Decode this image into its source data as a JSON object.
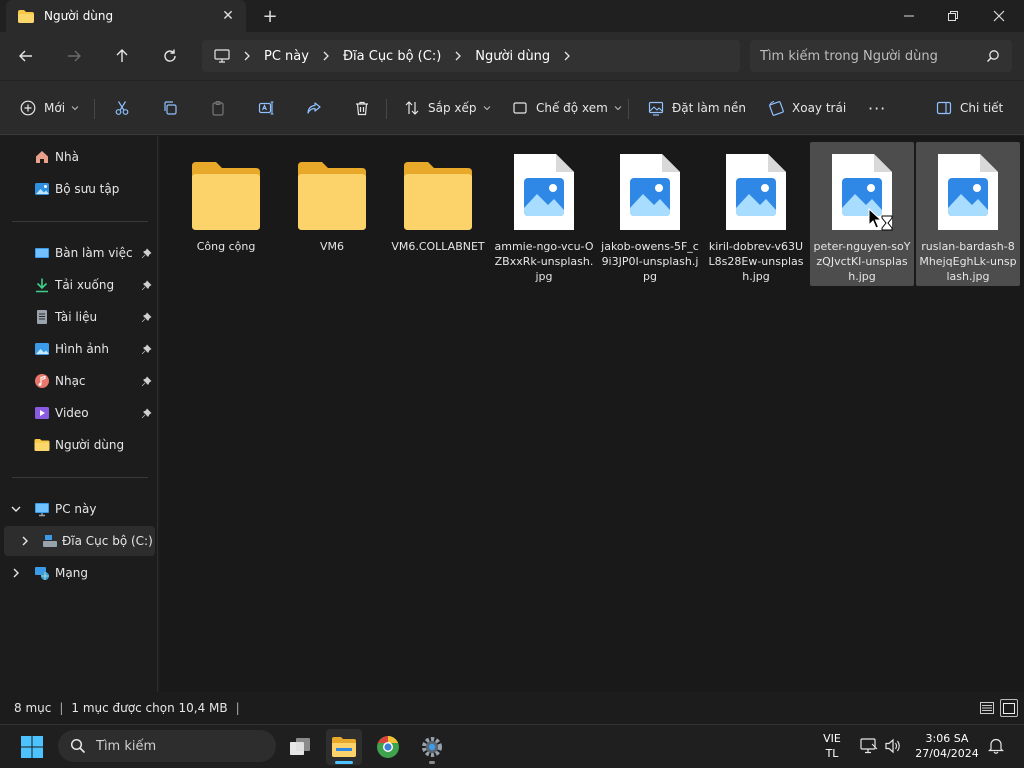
{
  "window": {
    "tab_title": "Người dùng",
    "close_tab": "✕",
    "new_tab": "+"
  },
  "address": {
    "breadcrumb": [
      "PC này",
      "Đĩa Cục bộ (C:)",
      "Người dùng"
    ],
    "search_placeholder": "Tìm kiếm trong Người dùng"
  },
  "toolbar": {
    "new_label": "Mới",
    "sort_label": "Sắp xếp",
    "view_label": "Chế độ xem",
    "set_background_label": "Đặt làm nền",
    "rotate_left_label": "Xoay trái",
    "more_label": "···",
    "details_label": "Chi tiết"
  },
  "sidebar": {
    "home": "Nhà",
    "gallery": "Bộ sưu tập",
    "pinned": [
      {
        "label": "Bàn làm việc",
        "icon": "desktop-icon"
      },
      {
        "label": "Tải xuống",
        "icon": "download-icon"
      },
      {
        "label": "Tài liệu",
        "icon": "documents-icon"
      },
      {
        "label": "Hình ảnh",
        "icon": "pictures-icon"
      },
      {
        "label": "Nhạc",
        "icon": "music-icon"
      },
      {
        "label": "Video",
        "icon": "video-icon"
      },
      {
        "label": "Người dùng",
        "icon": "folder-icon"
      }
    ],
    "this_pc": "PC này",
    "local_disk": "Đĩa Cục bộ (C:)",
    "network": "Mạng"
  },
  "files": [
    {
      "name": "Công cộng",
      "type": "folder",
      "selected": false
    },
    {
      "name": "VM6",
      "type": "folder",
      "selected": false
    },
    {
      "name": "VM6.COLLABNET",
      "type": "folder",
      "selected": false
    },
    {
      "name": "ammie-ngo-vcu-OZBxxRk-unsplash.jpg",
      "type": "image",
      "selected": false
    },
    {
      "name": "jakob-owens-5F_c9i3JP0I-unsplash.jpg",
      "type": "image",
      "selected": false
    },
    {
      "name": "kiril-dobrev-v63UL8s28Ew-unsplash.jpg",
      "type": "image",
      "selected": false
    },
    {
      "name": "peter-nguyen-soYzQJvctKI-unsplash.jpg",
      "type": "image",
      "selected": true
    },
    {
      "name": "ruslan-bardash-8MhejqEghLk-unsplash.jpg",
      "type": "image",
      "selected": true
    }
  ],
  "status": {
    "count": "8 mục",
    "selected": "1 mục được chọn  10,4 MB"
  },
  "taskbar": {
    "search_placeholder": "Tìm kiếm",
    "lang_line1": "VIE",
    "lang_line2": "TL",
    "time": "3:06 SA",
    "date": "27/04/2024"
  },
  "colors": {
    "accent": "#4cc2ff",
    "folder": "#f8c846",
    "selection": "#4d4d4d"
  }
}
